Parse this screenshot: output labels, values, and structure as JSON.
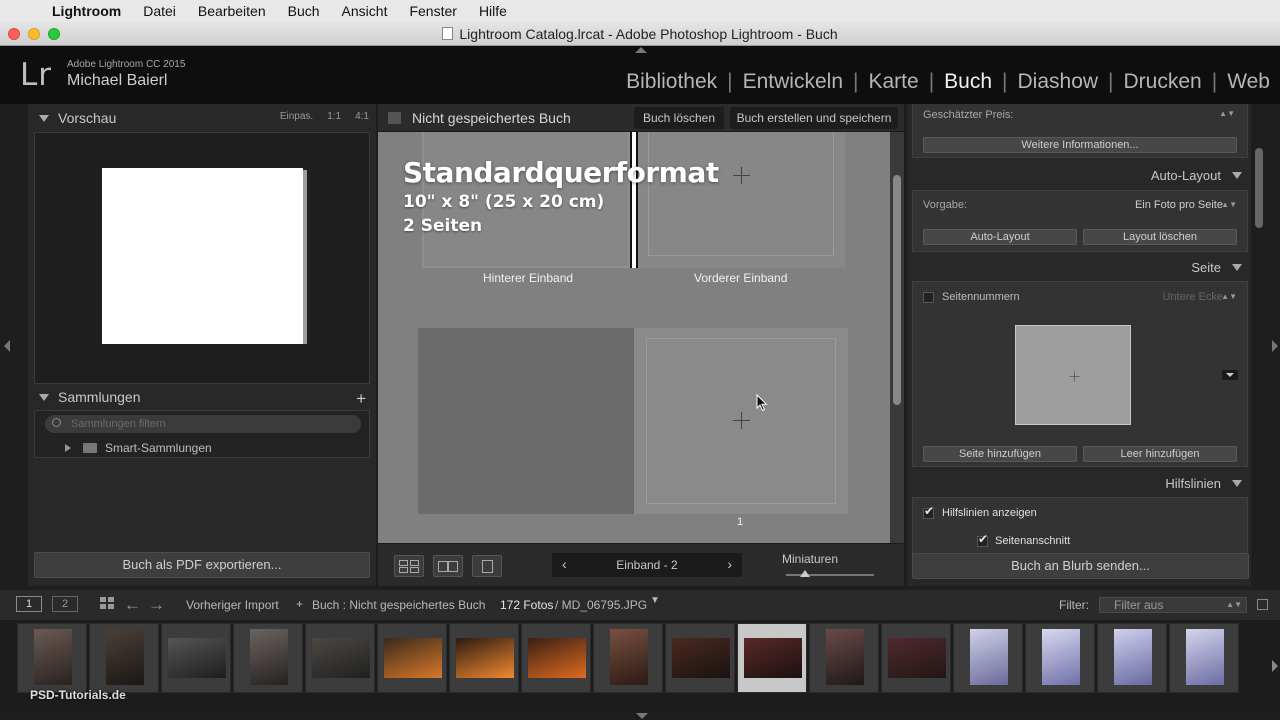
{
  "menubar": {
    "items": [
      "Lightroom",
      "Datei",
      "Bearbeiten",
      "Buch",
      "Ansicht",
      "Fenster",
      "Hilfe"
    ]
  },
  "window": {
    "title": "Lightroom Catalog.lrcat - Adobe Photoshop Lightroom - Buch"
  },
  "identity": {
    "logo": "Lr",
    "product": "Adobe Lightroom CC 2015",
    "user": "Michael Baierl"
  },
  "modules": {
    "items": [
      "Bibliothek",
      "Entwickeln",
      "Karte",
      "Buch",
      "Diashow",
      "Drucken",
      "Web"
    ],
    "separator": "|",
    "active": "Buch"
  },
  "left_panel": {
    "preview": {
      "title": "Vorschau",
      "options": [
        "Einpas.",
        "1:1",
        "4:1"
      ]
    },
    "collections": {
      "title": "Sammlungen",
      "add_symbol": "+",
      "search_placeholder": "Sammlungen filtern",
      "items": [
        "Smart-Sammlungen"
      ]
    },
    "export_button": "Buch als PDF exportieren..."
  },
  "center": {
    "toolbar": {
      "title": "Nicht gespeichertes Buch",
      "delete_button": "Buch löschen",
      "create_button": "Buch erstellen und speichern"
    },
    "overlay": {
      "format": "Standardquerformat",
      "size": "10\" x 8\" (25 x 20 cm)",
      "pages": "2 Seiten"
    },
    "cover_labels": {
      "back": "Hinterer Einband",
      "front": "Vorderer Einband"
    },
    "page_number": "1",
    "nav": {
      "prev": "‹",
      "label": "Einband - 2",
      "next": "›"
    },
    "thumbnails_label": "Miniaturen"
  },
  "right_panel": {
    "price_label": "Geschätzter Preis:",
    "more_info_button": "Weitere Informationen...",
    "auto_layout": {
      "title": "Auto-Layout",
      "preset_label": "Vorgabe:",
      "preset_value": "Ein Foto pro Seite",
      "auto_button": "Auto-Layout",
      "clear_button": "Layout löschen"
    },
    "page": {
      "title": "Seite",
      "page_numbers_label": "Seitennummern",
      "page_numbers_value": "Untere Ecke",
      "add_page_button": "Seite hinzufügen",
      "add_blank_button": "Leer hinzufügen"
    },
    "guides": {
      "title": "Hilfslinien",
      "show_guides": "Hilfslinien anzeigen",
      "page_bleed": "Seitenanschnitt"
    },
    "send_button": "Buch an Blurb senden..."
  },
  "filmstrip_bar": {
    "screen1": "1",
    "screen2": "2",
    "source": "Vorheriger Import",
    "plus": "+",
    "book": "Buch : Nicht gespeichertes Buch",
    "count": "172 Fotos",
    "file": "/ MD_06795.JPG",
    "filter_label": "Filter:",
    "filter_value": "Filter aus"
  },
  "filmstrip": {
    "thumbnail_count": 17,
    "selected_index": 10
  },
  "watermark": "PSD-Tutorials.de"
}
